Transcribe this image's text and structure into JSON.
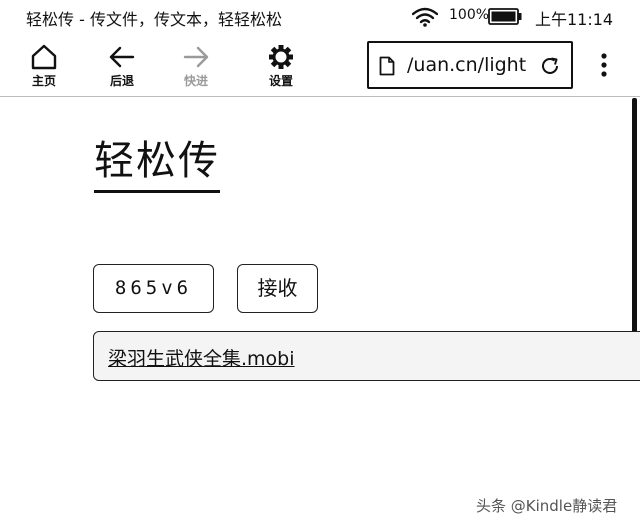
{
  "status_bar": {
    "title": "轻松传 - 传文件，传文本，轻轻松松",
    "battery": "100%",
    "time": "上午11:14"
  },
  "toolbar": {
    "home_label": "主页",
    "back_label": "后退",
    "forward_label": "快进",
    "settings_label": "设置",
    "url": "uan.cn/light/"
  },
  "page": {
    "brand": "轻松传",
    "code": "865v6",
    "receive_button": "接收",
    "file_name": "梁羽生武侠全集.mobi"
  },
  "watermark": "头条 @Kindle静读君"
}
